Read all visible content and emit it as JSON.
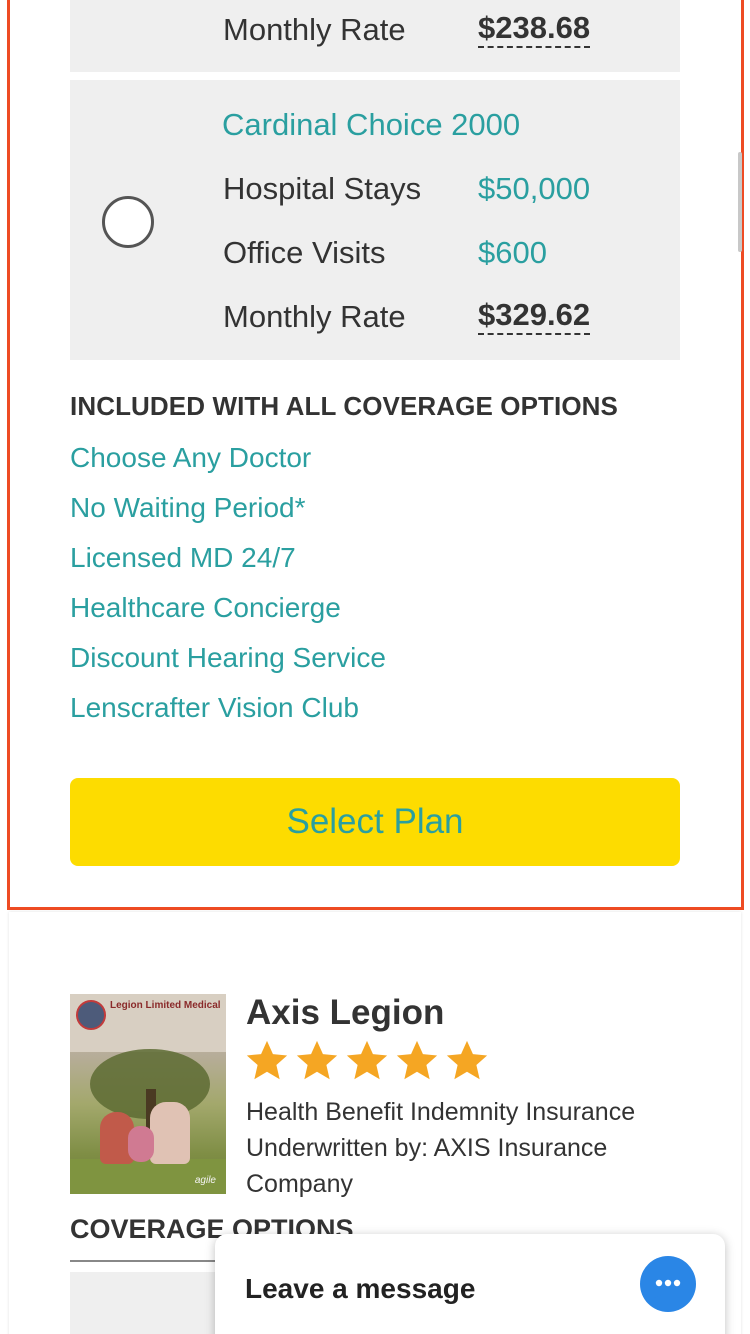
{
  "plan_prev": {
    "rate_label": "Monthly Rate",
    "rate_value": "$238.68"
  },
  "plan_main": {
    "name": "Cardinal Choice 2000",
    "rows": [
      {
        "label": "Hospital Stays",
        "value": "$50,000"
      },
      {
        "label": "Office Visits",
        "value": "$600"
      }
    ],
    "rate_label": "Monthly Rate",
    "rate_value": "$329.62"
  },
  "included": {
    "title": "INCLUDED WITH ALL COVERAGE OPTIONS",
    "items": [
      "Choose Any Doctor",
      "No Waiting Period*",
      "Licensed MD 24/7",
      "Healthcare Concierge",
      "Discount Hearing Service",
      "Lenscrafter Vision Club"
    ]
  },
  "select_button": "Select Plan",
  "product": {
    "title": "Axis Legion",
    "rating": 5,
    "rating_max": 5,
    "desc_line1": "Health Benefit Indemnity Insurance",
    "desc_line2": "Underwritten by: AXIS Insurance",
    "desc_line3": "Company",
    "brochure_title": "Legion Limited Medical",
    "brochure_brand": "agile"
  },
  "coverage_title": "COVERAGE OPTIONS",
  "chat": {
    "label": "Leave a message",
    "icon": "chat-bubble-icon"
  },
  "colors": {
    "accent_teal": "#2a9fa0",
    "selected_border": "#ee4b23",
    "button_yellow": "#fddc00",
    "star_orange": "#f5a623",
    "chat_blue": "#2a86e6"
  }
}
